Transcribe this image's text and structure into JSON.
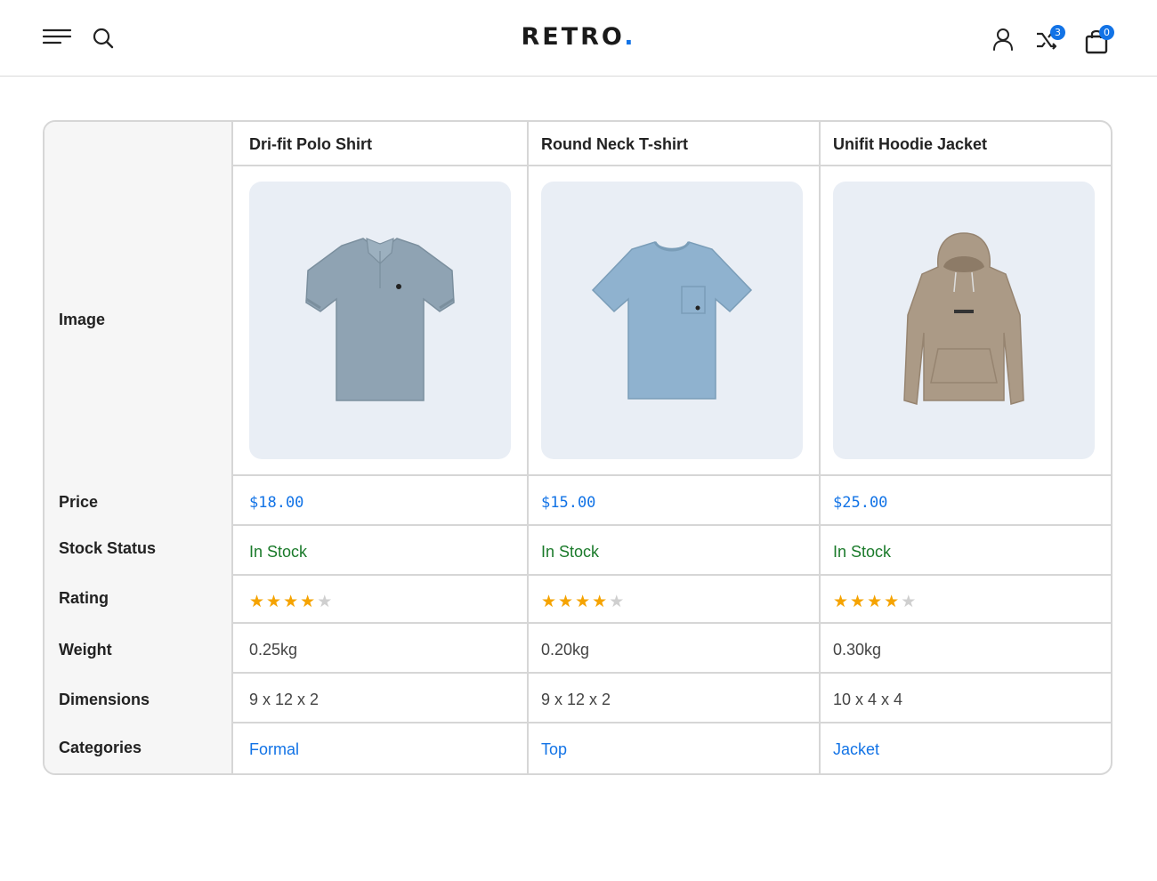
{
  "header": {
    "logo_text": "RETRO",
    "logo_dot": ".",
    "compare_count": "3",
    "cart_count": "0",
    "accent_color": "#1273e6"
  },
  "row_labels": [
    "Image",
    "Price",
    "Stock Status",
    "Rating",
    "Weight",
    "Dimensions",
    "Categories"
  ],
  "products": [
    {
      "name": "Dri-fit Polo Shirt",
      "image_icon": "polo-shirt-image",
      "price": "$18.00",
      "stock": "In Stock",
      "rating": 4,
      "rating_max": 5,
      "weight": "0.25kg",
      "dimensions": "9 x 12 x 2",
      "category": "Formal"
    },
    {
      "name": "Round Neck T-shirt",
      "image_icon": "tshirt-image",
      "price": "$15.00",
      "stock": "In Stock",
      "rating": 4,
      "rating_max": 5,
      "weight": "0.20kg",
      "dimensions": "9 x 12 x 2",
      "category": "Top"
    },
    {
      "name": "Unifit Hoodie Jacket",
      "image_icon": "hoodie-image",
      "price": "$25.00",
      "stock": "In Stock",
      "rating": 4,
      "rating_max": 5,
      "weight": "0.30kg",
      "dimensions": "10 x 4 x 4",
      "category": "Jacket"
    }
  ],
  "colors": {
    "price": "#1273e6",
    "stock": "#1a7a2a",
    "star_on": "#f5a300",
    "star_off": "#cfcfcf"
  }
}
